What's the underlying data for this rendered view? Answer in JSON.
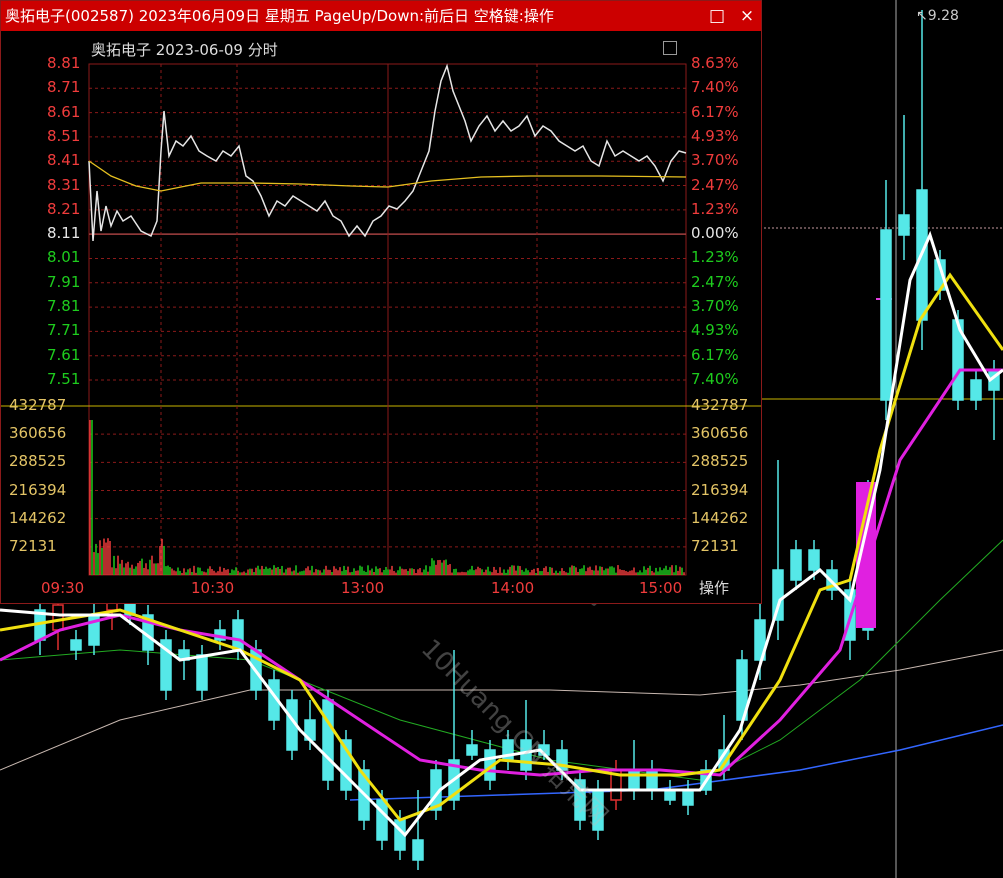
{
  "window": {
    "title": "奥拓电子(002587) 2023年06月09日 星期五 PageUp/Down:前后日 空格键:操作",
    "restore_icon": "□",
    "close_icon": "×"
  },
  "intraday": {
    "title": "奥拓电子  2023-06-09 分时",
    "price_labels": [
      "8.81",
      "8.71",
      "8.61",
      "8.51",
      "8.41",
      "8.31",
      "8.21",
      "8.11",
      "8.01",
      "7.91",
      "7.81",
      "7.71",
      "7.61",
      "7.51"
    ],
    "pct_labels": [
      "8.63%",
      "7.40%",
      "6.17%",
      "4.93%",
      "3.70%",
      "2.47%",
      "1.23%",
      "0.00%",
      "1.23%",
      "2.47%",
      "3.70%",
      "4.93%",
      "6.17%",
      "7.40%"
    ],
    "volume_labels": [
      "432787",
      "360656",
      "288525",
      "216394",
      "144262",
      "72131"
    ],
    "time_labels": [
      "09:30",
      "10:30",
      "13:00",
      "14:00",
      "15:00"
    ],
    "operate_label": "操作",
    "colors": {
      "up": "#f03c3c",
      "down": "#1ecc1e",
      "flat": "#e6e6e6",
      "avg_line": "#e6c020",
      "grid": "#8b1a1a"
    }
  },
  "kline": {
    "high_marker": "9.28",
    "right_axis_value": "432787"
  },
  "watermark": "10Huang.CN 拾荒网"
}
